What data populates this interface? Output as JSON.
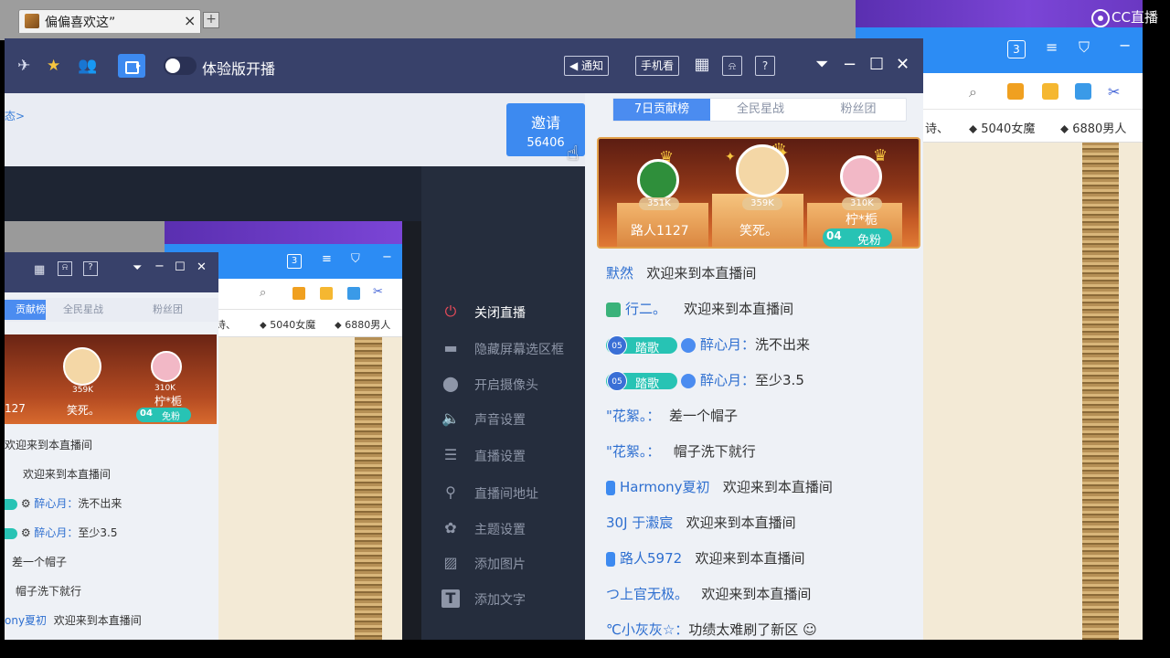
{
  "browser_tab": {
    "title": "偏偏喜欢这”",
    "close": "×",
    "new_tab": "+"
  },
  "watermark": {
    "text": "CC直播"
  },
  "bg_browser": {
    "badge_count": "3",
    "favorites": [
      "诗、",
      "5040女魔",
      "6880男人"
    ]
  },
  "toolbar": {
    "trial_label": "体验版开播",
    "notify_label": "通知",
    "phone_label": "手机看",
    "help_label": "?",
    "icons": [
      "plane-icon",
      "star-icon",
      "users-icon",
      "camera-icon"
    ]
  },
  "invite": {
    "status_link": "态>",
    "label": "邀请",
    "count": "56406"
  },
  "side_menu": [
    {
      "label": "关闭直播",
      "icon": "power-icon"
    },
    {
      "label": "隐藏屏幕选区框",
      "icon": "screen-icon"
    },
    {
      "label": "开启摄像头",
      "icon": "camera-pin-icon"
    },
    {
      "label": "声音设置",
      "icon": "speaker-icon"
    },
    {
      "label": "直播设置",
      "icon": "sliders-icon"
    },
    {
      "label": "直播间地址",
      "icon": "location-icon"
    },
    {
      "label": "主题设置",
      "icon": "palette-icon"
    },
    {
      "label": "添加图片",
      "icon": "image-icon"
    },
    {
      "label": "添加文字",
      "icon": "text-icon"
    }
  ],
  "rank_tabs": [
    "7日贡献榜",
    "全民星战",
    "粉丝团"
  ],
  "podium": {
    "first": {
      "name": "笑死。",
      "score": "359K"
    },
    "second": {
      "name": "路人1127",
      "score": "351K"
    },
    "third": {
      "name": "柠*栀",
      "score": "310K"
    },
    "fan_level": "04",
    "fan_label": "免粉"
  },
  "chat": [
    {
      "name": "默然",
      "msg": "欢迎来到本直播间"
    },
    {
      "name": "行二。",
      "msg": "欢迎来到本直播间"
    },
    {
      "badge_level": "05",
      "badge_text": "踏歌",
      "name": "醉心月：",
      "msg": "洗不出来"
    },
    {
      "badge_level": "05",
      "badge_text": "踏歌",
      "name": "醉心月：",
      "msg": "至少3.5"
    },
    {
      "name": "\"花絮。：",
      "msg": "差一个帽子"
    },
    {
      "name": "\"花絮。：",
      "msg": "帽子洗下就行"
    },
    {
      "name": "Harmony夏初",
      "msg": "欢迎来到本直播间"
    },
    {
      "name": "30J 于瀫宸",
      "msg": "欢迎来到本直播间"
    },
    {
      "name": "路人5972",
      "msg": "欢迎来到本直播间"
    },
    {
      "name": "つ上官无极。",
      "msg": "欢迎来到本直播间"
    },
    {
      "name": "℃小灰灰☆：",
      "msg": "功绩太难刷了新区"
    }
  ],
  "nested": {
    "rank_tabs": [
      "贡献榜",
      "全民星战",
      "粉丝团"
    ],
    "badge_count": "3",
    "favorites": [
      "诗、",
      "5040女魔",
      "6880男人"
    ],
    "podium_names": [
      "127",
      "笑死。",
      "柠*栀"
    ],
    "podium_scores": [
      "359K",
      "310K"
    ],
    "fan_level": "04",
    "fan_label": "免粉",
    "chat": [
      {
        "name": "",
        "msg": "欢迎来到本直播间"
      },
      {
        "name": "",
        "msg": "欢迎来到本直播间"
      },
      {
        "name": "醉心月：",
        "msg": "洗不出来"
      },
      {
        "name": "醉心月：",
        "msg": "至少3.5"
      },
      {
        "name": "",
        "msg": "差一个帽子"
      },
      {
        "name": "",
        "msg": "帽子洗下就行"
      },
      {
        "name": "ony夏初",
        "msg": "欢迎来到本直播间"
      }
    ]
  },
  "colors": {
    "accent": "#3d8af0",
    "header": "#38416a",
    "fan_teal": "#27c3b4",
    "live_red": "#e84b5a"
  }
}
